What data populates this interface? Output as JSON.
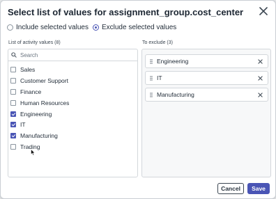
{
  "dialog": {
    "title": "Select list of values for assignment_group.cost_center"
  },
  "mode": {
    "include_label": "Include selected values",
    "exclude_label": "Exclude selected values",
    "selected": "exclude"
  },
  "left": {
    "label": "List of activity values (8)",
    "search_placeholder": "Search",
    "items": [
      {
        "label": "Sales",
        "checked": false
      },
      {
        "label": "Customer Support",
        "checked": false
      },
      {
        "label": "Finance",
        "checked": false
      },
      {
        "label": "Human Resources",
        "checked": false
      },
      {
        "label": "Engineering",
        "checked": true
      },
      {
        "label": "IT",
        "checked": true
      },
      {
        "label": "Manufacturing",
        "checked": true
      },
      {
        "label": "Trading",
        "checked": false
      }
    ]
  },
  "right": {
    "label": "To exclude (3)",
    "items": [
      {
        "label": "Engineering"
      },
      {
        "label": "IT"
      },
      {
        "label": "Manufacturing"
      }
    ]
  },
  "footer": {
    "cancel_label": "Cancel",
    "save_label": "Save"
  },
  "colors": {
    "accent": "#4a55b5",
    "border": "#d3d7db",
    "text": "#1f2a36"
  },
  "icons": {
    "close": "close-icon",
    "search": "search-icon",
    "drag": "drag-handle-icon",
    "remove": "remove-icon",
    "cursor": "mouse-cursor-icon"
  }
}
